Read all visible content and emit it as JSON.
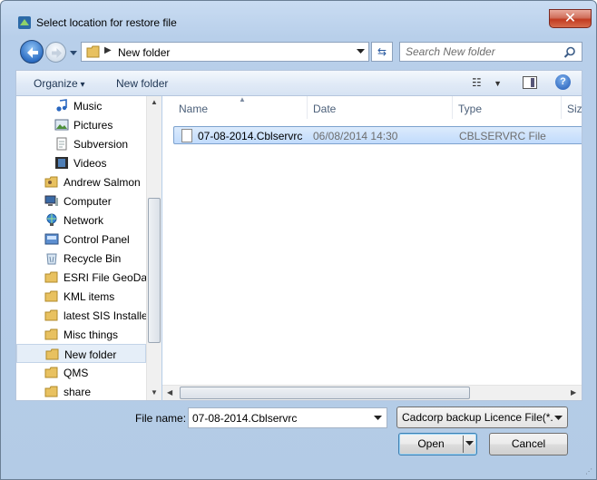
{
  "window": {
    "title": "Select location for restore file",
    "close_label": "✕"
  },
  "address": {
    "crumb": "New folder"
  },
  "search": {
    "placeholder": "Search New folder"
  },
  "toolbar": {
    "organize_label": "Organize",
    "new_folder_label": "New folder",
    "help_label": "?"
  },
  "nav": {
    "items": [
      {
        "label": "Music",
        "icon": "music-icon"
      },
      {
        "label": "Pictures",
        "icon": "pictures-icon"
      },
      {
        "label": "Subversion",
        "icon": "document-icon"
      },
      {
        "label": "Videos",
        "icon": "videos-icon"
      },
      {
        "label": "Andrew Salmon",
        "icon": "user-folder-icon"
      },
      {
        "label": "Computer",
        "icon": "computer-icon"
      },
      {
        "label": "Network",
        "icon": "network-icon"
      },
      {
        "label": "Control Panel",
        "icon": "control-panel-icon"
      },
      {
        "label": "Recycle Bin",
        "icon": "recycle-bin-icon"
      },
      {
        "label": "ESRI File GeoData",
        "icon": "folder-icon"
      },
      {
        "label": "KML items",
        "icon": "folder-icon"
      },
      {
        "label": "latest SIS Installer",
        "icon": "folder-icon"
      },
      {
        "label": "Misc things",
        "icon": "folder-icon"
      },
      {
        "label": "New folder",
        "icon": "folder-icon",
        "selected": true
      },
      {
        "label": "QMS",
        "icon": "folder-icon"
      },
      {
        "label": "share",
        "icon": "folder-icon"
      }
    ]
  },
  "columns": {
    "name": "Name",
    "date": "Date",
    "type": "Type",
    "size": "Size"
  },
  "files": [
    {
      "name": "07-08-2014.Cblservrc",
      "date": "06/08/2014 14:30",
      "type": "CBLSERVRC File"
    }
  ],
  "footer": {
    "file_name_label": "File name:",
    "file_name_value": "07-08-2014.Cblservrc",
    "filter_value": "Cadcorp backup Licence File(*.",
    "open_label": "Open",
    "cancel_label": "Cancel"
  },
  "colors": {
    "selection": "#c1dbfc",
    "chrome": "#b8cfea",
    "folder": "#e8c160"
  }
}
